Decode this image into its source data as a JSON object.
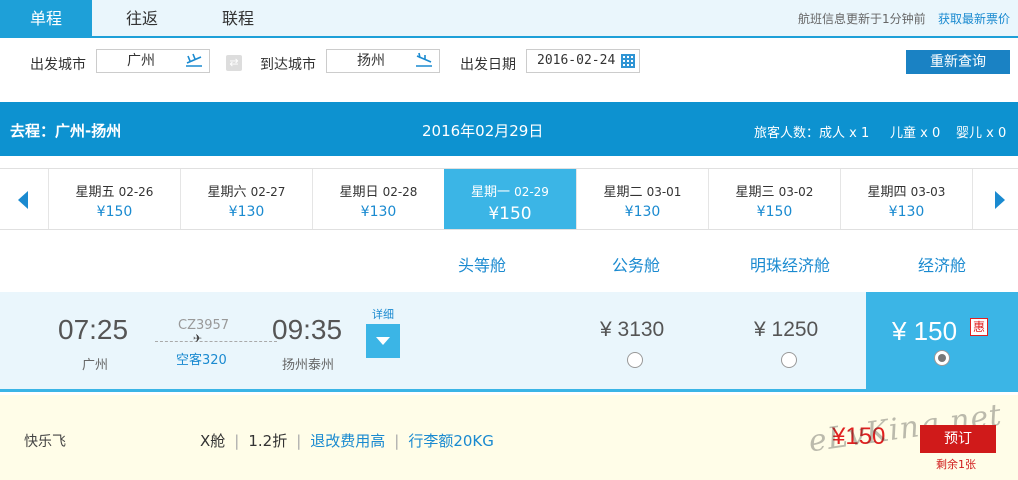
{
  "tabs": [
    {
      "label": "单程",
      "active": true
    },
    {
      "label": "往返",
      "active": false
    },
    {
      "label": "联程",
      "active": false
    }
  ],
  "top_note": "航班信息更新于1分钟前",
  "top_link": "获取最新票价",
  "search": {
    "from_label": "出发城市",
    "from_value": "广州",
    "to_label": "到达城市",
    "to_value": "扬州",
    "date_label": "出发日期",
    "date_value": "2016-02-24",
    "requery_label": "重新查询"
  },
  "route": {
    "title": "去程：广州-扬州",
    "date": "2016年02月29日",
    "pax_label": "旅客人数：成人 x 1",
    "child_label": "儿童 x 0",
    "infant_label": "婴儿 x 0"
  },
  "dates": [
    {
      "weekday": "星期五",
      "date": "02-26",
      "price": "¥150"
    },
    {
      "weekday": "星期六",
      "date": "02-27",
      "price": "¥130"
    },
    {
      "weekday": "星期日",
      "date": "02-28",
      "price": "¥130"
    },
    {
      "weekday": "星期一",
      "date": "02-29",
      "price": "¥150"
    },
    {
      "weekday": "星期二",
      "date": "03-01",
      "price": "¥130"
    },
    {
      "weekday": "星期三",
      "date": "03-02",
      "price": "¥150"
    },
    {
      "weekday": "星期四",
      "date": "03-03",
      "price": "¥130"
    }
  ],
  "cabins": [
    "头等舱",
    "公务舱",
    "明珠经济舱",
    "经济舱"
  ],
  "flight": {
    "dep_time": "07:25",
    "dep_city": "广州",
    "flight_no": "CZ3957",
    "aircraft": "空客320",
    "arr_time": "09:35",
    "arr_city": "扬州泰州",
    "detail_label": "详细",
    "business_price": "¥ 3130",
    "premium_price": "¥ 1250",
    "economy_price": "¥ 150",
    "promo_badge": "惠"
  },
  "fare": {
    "name": "快乐飞",
    "cabin_class": "X舱",
    "discount": "1.2折",
    "change_fee": "退改费用高",
    "baggage": "行李额20KG",
    "price": "¥150",
    "book_label": "预订",
    "remaining": "剩余1张"
  },
  "watermark": "eLvKing.net",
  "colors": {
    "brand_blue": "#1ea0d8",
    "route_bar": "#0d92d0",
    "active_day": "#3bb5e6",
    "book_red": "#d01a1a",
    "fare_bg": "#fffde8"
  }
}
